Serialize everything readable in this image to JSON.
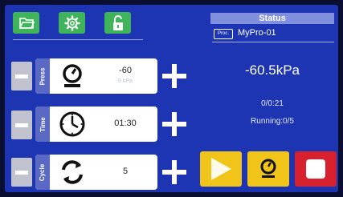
{
  "toolbar": {
    "open": {
      "icon": "folder-open-icon"
    },
    "settings": {
      "icon": "gear-icon"
    },
    "lock": {
      "icon": "unlock-icon"
    }
  },
  "controls": [
    {
      "label": "Press",
      "icon": "pressure-gauge-icon",
      "value": "-60",
      "unit": "0 kPa"
    },
    {
      "label": "Time",
      "icon": "clock-icon",
      "value": "01:30"
    },
    {
      "label": "Cycle",
      "icon": "cycle-arrows-icon",
      "value": "5"
    }
  ],
  "status": {
    "title": "Status",
    "program_badge": "Proc.",
    "program_name": "MyPro-01",
    "pressure": "-60.5kPa",
    "elapsed": "0/0:21",
    "running": "Running:0/5"
  },
  "actions": {
    "play": {
      "icon": "play-icon",
      "color": "#f0c419"
    },
    "gauge": {
      "icon": "pressure-gauge-icon",
      "color": "#f0c419"
    },
    "stop": {
      "icon": "stop-icon",
      "color": "#d8212f"
    }
  },
  "colors": {
    "background": "#1d35b3",
    "toolbar_green": "#3fb45a",
    "yellow": "#f0c419",
    "red": "#d8212f"
  }
}
